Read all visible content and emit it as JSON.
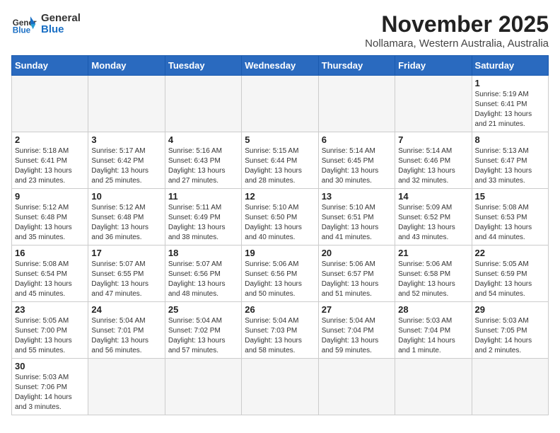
{
  "header": {
    "logo_general": "General",
    "logo_blue": "Blue",
    "month_title": "November 2025",
    "subtitle": "Nollamara, Western Australia, Australia"
  },
  "weekdays": [
    "Sunday",
    "Monday",
    "Tuesday",
    "Wednesday",
    "Thursday",
    "Friday",
    "Saturday"
  ],
  "days": [
    {
      "num": "",
      "info": ""
    },
    {
      "num": "",
      "info": ""
    },
    {
      "num": "",
      "info": ""
    },
    {
      "num": "",
      "info": ""
    },
    {
      "num": "",
      "info": ""
    },
    {
      "num": "",
      "info": ""
    },
    {
      "num": "1",
      "info": "Sunrise: 5:19 AM\nSunset: 6:41 PM\nDaylight: 13 hours\nand 21 minutes."
    },
    {
      "num": "2",
      "info": "Sunrise: 5:18 AM\nSunset: 6:41 PM\nDaylight: 13 hours\nand 23 minutes."
    },
    {
      "num": "3",
      "info": "Sunrise: 5:17 AM\nSunset: 6:42 PM\nDaylight: 13 hours\nand 25 minutes."
    },
    {
      "num": "4",
      "info": "Sunrise: 5:16 AM\nSunset: 6:43 PM\nDaylight: 13 hours\nand 27 minutes."
    },
    {
      "num": "5",
      "info": "Sunrise: 5:15 AM\nSunset: 6:44 PM\nDaylight: 13 hours\nand 28 minutes."
    },
    {
      "num": "6",
      "info": "Sunrise: 5:14 AM\nSunset: 6:45 PM\nDaylight: 13 hours\nand 30 minutes."
    },
    {
      "num": "7",
      "info": "Sunrise: 5:14 AM\nSunset: 6:46 PM\nDaylight: 13 hours\nand 32 minutes."
    },
    {
      "num": "8",
      "info": "Sunrise: 5:13 AM\nSunset: 6:47 PM\nDaylight: 13 hours\nand 33 minutes."
    },
    {
      "num": "9",
      "info": "Sunrise: 5:12 AM\nSunset: 6:48 PM\nDaylight: 13 hours\nand 35 minutes."
    },
    {
      "num": "10",
      "info": "Sunrise: 5:12 AM\nSunset: 6:48 PM\nDaylight: 13 hours\nand 36 minutes."
    },
    {
      "num": "11",
      "info": "Sunrise: 5:11 AM\nSunset: 6:49 PM\nDaylight: 13 hours\nand 38 minutes."
    },
    {
      "num": "12",
      "info": "Sunrise: 5:10 AM\nSunset: 6:50 PM\nDaylight: 13 hours\nand 40 minutes."
    },
    {
      "num": "13",
      "info": "Sunrise: 5:10 AM\nSunset: 6:51 PM\nDaylight: 13 hours\nand 41 minutes."
    },
    {
      "num": "14",
      "info": "Sunrise: 5:09 AM\nSunset: 6:52 PM\nDaylight: 13 hours\nand 43 minutes."
    },
    {
      "num": "15",
      "info": "Sunrise: 5:08 AM\nSunset: 6:53 PM\nDaylight: 13 hours\nand 44 minutes."
    },
    {
      "num": "16",
      "info": "Sunrise: 5:08 AM\nSunset: 6:54 PM\nDaylight: 13 hours\nand 45 minutes."
    },
    {
      "num": "17",
      "info": "Sunrise: 5:07 AM\nSunset: 6:55 PM\nDaylight: 13 hours\nand 47 minutes."
    },
    {
      "num": "18",
      "info": "Sunrise: 5:07 AM\nSunset: 6:56 PM\nDaylight: 13 hours\nand 48 minutes."
    },
    {
      "num": "19",
      "info": "Sunrise: 5:06 AM\nSunset: 6:56 PM\nDaylight: 13 hours\nand 50 minutes."
    },
    {
      "num": "20",
      "info": "Sunrise: 5:06 AM\nSunset: 6:57 PM\nDaylight: 13 hours\nand 51 minutes."
    },
    {
      "num": "21",
      "info": "Sunrise: 5:06 AM\nSunset: 6:58 PM\nDaylight: 13 hours\nand 52 minutes."
    },
    {
      "num": "22",
      "info": "Sunrise: 5:05 AM\nSunset: 6:59 PM\nDaylight: 13 hours\nand 54 minutes."
    },
    {
      "num": "23",
      "info": "Sunrise: 5:05 AM\nSunset: 7:00 PM\nDaylight: 13 hours\nand 55 minutes."
    },
    {
      "num": "24",
      "info": "Sunrise: 5:04 AM\nSunset: 7:01 PM\nDaylight: 13 hours\nand 56 minutes."
    },
    {
      "num": "25",
      "info": "Sunrise: 5:04 AM\nSunset: 7:02 PM\nDaylight: 13 hours\nand 57 minutes."
    },
    {
      "num": "26",
      "info": "Sunrise: 5:04 AM\nSunset: 7:03 PM\nDaylight: 13 hours\nand 58 minutes."
    },
    {
      "num": "27",
      "info": "Sunrise: 5:04 AM\nSunset: 7:04 PM\nDaylight: 13 hours\nand 59 minutes."
    },
    {
      "num": "28",
      "info": "Sunrise: 5:03 AM\nSunset: 7:04 PM\nDaylight: 14 hours\nand 1 minute."
    },
    {
      "num": "29",
      "info": "Sunrise: 5:03 AM\nSunset: 7:05 PM\nDaylight: 14 hours\nand 2 minutes."
    },
    {
      "num": "30",
      "info": "Sunrise: 5:03 AM\nSunset: 7:06 PM\nDaylight: 14 hours\nand 3 minutes."
    },
    {
      "num": "",
      "info": ""
    },
    {
      "num": "",
      "info": ""
    },
    {
      "num": "",
      "info": ""
    },
    {
      "num": "",
      "info": ""
    },
    {
      "num": "",
      "info": ""
    },
    {
      "num": "",
      "info": ""
    }
  ]
}
